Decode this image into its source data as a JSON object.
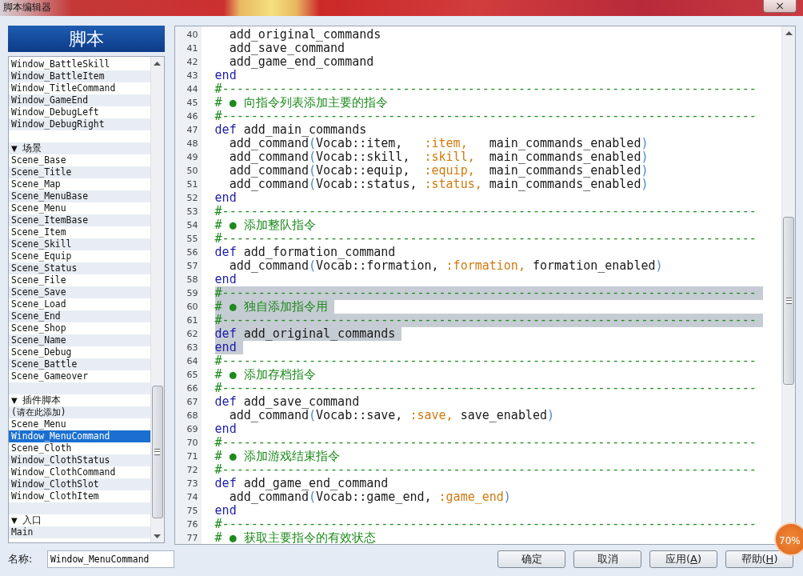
{
  "window": {
    "title": "脚本编辑器",
    "close": "×"
  },
  "panel": {
    "title": "脚本"
  },
  "script_list": {
    "items": [
      {
        "kind": "script",
        "label": "Window_BattleSkill",
        "selected": false
      },
      {
        "kind": "script",
        "label": "Window_BattleItem",
        "selected": false
      },
      {
        "kind": "script",
        "label": "Window_TitleCommand",
        "selected": false
      },
      {
        "kind": "script",
        "label": "Window_GameEnd",
        "selected": false
      },
      {
        "kind": "script",
        "label": "Window_DebugLeft",
        "selected": false
      },
      {
        "kind": "script",
        "label": "Window_DebugRight",
        "selected": false
      },
      {
        "kind": "blank",
        "selected": false
      },
      {
        "kind": "group",
        "arrow": "▼",
        "label": "场景",
        "selected": false
      },
      {
        "kind": "script",
        "label": "Scene_Base",
        "selected": false
      },
      {
        "kind": "script",
        "label": "Scene_Title",
        "selected": false
      },
      {
        "kind": "script",
        "label": "Scene_Map",
        "selected": false
      },
      {
        "kind": "script",
        "label": "Scene_MenuBase",
        "selected": false
      },
      {
        "kind": "script",
        "label": "Scene_Menu",
        "selected": false
      },
      {
        "kind": "script",
        "label": "Scene_ItemBase",
        "selected": false
      },
      {
        "kind": "script",
        "label": "Scene_Item",
        "selected": false
      },
      {
        "kind": "script",
        "label": "Scene_Skill",
        "selected": false
      },
      {
        "kind": "script",
        "label": "Scene_Equip",
        "selected": false
      },
      {
        "kind": "script",
        "label": "Scene_Status",
        "selected": false
      },
      {
        "kind": "script",
        "label": "Scene_File",
        "selected": false
      },
      {
        "kind": "script",
        "label": "Scene_Save",
        "selected": false
      },
      {
        "kind": "script",
        "label": "Scene_Load",
        "selected": false
      },
      {
        "kind": "script",
        "label": "Scene_End",
        "selected": false
      },
      {
        "kind": "script",
        "label": "Scene_Shop",
        "selected": false
      },
      {
        "kind": "script",
        "label": "Scene_Name",
        "selected": false
      },
      {
        "kind": "script",
        "label": "Scene_Debug",
        "selected": false
      },
      {
        "kind": "script",
        "label": "Scene_Battle",
        "selected": false
      },
      {
        "kind": "script",
        "label": "Scene_Gameover",
        "selected": false
      },
      {
        "kind": "blank",
        "selected": false
      },
      {
        "kind": "group",
        "arrow": "▼",
        "label": "插件脚本",
        "selected": false
      },
      {
        "kind": "script",
        "label": "(请在此添加)",
        "selected": false
      },
      {
        "kind": "script",
        "label": "Scene_Menu",
        "selected": false
      },
      {
        "kind": "script",
        "label": "Window_MenuCommand",
        "selected": true
      },
      {
        "kind": "script",
        "label": "Scene_Cloth",
        "selected": false
      },
      {
        "kind": "script",
        "label": "Window_ClothStatus",
        "selected": false
      },
      {
        "kind": "script",
        "label": "Window_ClothCommand",
        "selected": false
      },
      {
        "kind": "script",
        "label": "Window_ClothSlot",
        "selected": false
      },
      {
        "kind": "script",
        "label": "Window_ClothItem",
        "selected": false
      },
      {
        "kind": "blank",
        "selected": false
      },
      {
        "kind": "group",
        "arrow": "▼",
        "label": "入口",
        "selected": false
      },
      {
        "kind": "script",
        "label": "Main",
        "selected": false
      }
    ]
  },
  "editor": {
    "lines": [
      {
        "number": "40",
        "selected": false,
        "tokens": [
          {
            "kind": "plain",
            "text": "  add_original_commands"
          }
        ]
      },
      {
        "number": "41",
        "selected": false,
        "tokens": [
          {
            "kind": "plain",
            "text": "  add_save_command"
          }
        ]
      },
      {
        "number": "42",
        "selected": false,
        "tokens": [
          {
            "kind": "plain",
            "text": "  add_game_end_command"
          }
        ]
      },
      {
        "number": "43",
        "selected": false,
        "tokens": [
          {
            "kind": "keyword",
            "text": "end"
          }
        ]
      },
      {
        "number": "44",
        "selected": false,
        "tokens": [
          {
            "kind": "comment",
            "text": "#--------------------------------------------------------------------------"
          }
        ]
      },
      {
        "number": "45",
        "selected": false,
        "tokens": [
          {
            "kind": "comment",
            "text": "# ● 向指令列表添加主要的指令"
          }
        ]
      },
      {
        "number": "46",
        "selected": false,
        "tokens": [
          {
            "kind": "comment",
            "text": "#--------------------------------------------------------------------------"
          }
        ]
      },
      {
        "number": "47",
        "selected": false,
        "tokens": [
          {
            "kind": "keyword",
            "text": "def"
          },
          {
            "kind": "plain",
            "text": " add_main_commands"
          }
        ]
      },
      {
        "number": "48",
        "selected": false,
        "tokens": [
          {
            "kind": "plain",
            "text": "  add_command"
          },
          {
            "kind": "paren",
            "text": "("
          },
          {
            "kind": "plain",
            "text": "Vocab::item,   "
          },
          {
            "kind": "symbol",
            "text": ":item,"
          },
          {
            "kind": "plain",
            "text": "   main_commands_enabled"
          },
          {
            "kind": "paren",
            "text": ")"
          }
        ]
      },
      {
        "number": "49",
        "selected": false,
        "tokens": [
          {
            "kind": "plain",
            "text": "  add_command"
          },
          {
            "kind": "paren",
            "text": "("
          },
          {
            "kind": "plain",
            "text": "Vocab::skill,  "
          },
          {
            "kind": "symbol",
            "text": ":skill,"
          },
          {
            "kind": "plain",
            "text": "  main_commands_enabled"
          },
          {
            "kind": "paren",
            "text": ")"
          }
        ]
      },
      {
        "number": "50",
        "selected": false,
        "tokens": [
          {
            "kind": "plain",
            "text": "  add_command"
          },
          {
            "kind": "paren",
            "text": "("
          },
          {
            "kind": "plain",
            "text": "Vocab::equip,  "
          },
          {
            "kind": "symbol",
            "text": ":equip,"
          },
          {
            "kind": "plain",
            "text": "  main_commands_enabled"
          },
          {
            "kind": "paren",
            "text": ")"
          }
        ]
      },
      {
        "number": "51",
        "selected": false,
        "tokens": [
          {
            "kind": "plain",
            "text": "  add_command"
          },
          {
            "kind": "paren",
            "text": "("
          },
          {
            "kind": "plain",
            "text": "Vocab::status, "
          },
          {
            "kind": "symbol",
            "text": ":status,"
          },
          {
            "kind": "plain",
            "text": " main_commands_enabled"
          },
          {
            "kind": "paren",
            "text": ")"
          }
        ]
      },
      {
        "number": "52",
        "selected": false,
        "tokens": [
          {
            "kind": "keyword",
            "text": "end"
          }
        ]
      },
      {
        "number": "53",
        "selected": false,
        "tokens": [
          {
            "kind": "comment",
            "text": "#--------------------------------------------------------------------------"
          }
        ]
      },
      {
        "number": "54",
        "selected": false,
        "tokens": [
          {
            "kind": "comment",
            "text": "# ● 添加整队指令"
          }
        ]
      },
      {
        "number": "55",
        "selected": false,
        "tokens": [
          {
            "kind": "comment",
            "text": "#--------------------------------------------------------------------------"
          }
        ]
      },
      {
        "number": "56",
        "selected": false,
        "tokens": [
          {
            "kind": "keyword",
            "text": "def"
          },
          {
            "kind": "plain",
            "text": " add_formation_command"
          }
        ]
      },
      {
        "number": "57",
        "selected": false,
        "tokens": [
          {
            "kind": "plain",
            "text": "  add_command"
          },
          {
            "kind": "paren",
            "text": "("
          },
          {
            "kind": "plain",
            "text": "Vocab::formation, "
          },
          {
            "kind": "symbol",
            "text": ":formation,"
          },
          {
            "kind": "plain",
            "text": " formation_enabled"
          },
          {
            "kind": "paren",
            "text": ")"
          }
        ]
      },
      {
        "number": "58",
        "selected": false,
        "tokens": [
          {
            "kind": "keyword",
            "text": "end"
          }
        ]
      },
      {
        "number": "59",
        "selected": true,
        "tokens": [
          {
            "kind": "comment",
            "text": "#--------------------------------------------------------------------------"
          }
        ]
      },
      {
        "number": "60",
        "selected": true,
        "tokens": [
          {
            "kind": "comment",
            "text": "# ● 独自添加指令用"
          }
        ]
      },
      {
        "number": "61",
        "selected": true,
        "tokens": [
          {
            "kind": "comment",
            "text": "#--------------------------------------------------------------------------"
          }
        ]
      },
      {
        "number": "62",
        "selected": true,
        "tokens": [
          {
            "kind": "keyword",
            "text": "def"
          },
          {
            "kind": "plain",
            "text": " add_original_commands"
          }
        ]
      },
      {
        "number": "63",
        "selected": true,
        "tokens": [
          {
            "kind": "keyword",
            "text": "end"
          }
        ]
      },
      {
        "number": "64",
        "selected": false,
        "tokens": [
          {
            "kind": "comment",
            "text": "#--------------------------------------------------------------------------"
          }
        ]
      },
      {
        "number": "65",
        "selected": false,
        "tokens": [
          {
            "kind": "comment",
            "text": "# ● 添加存档指令"
          }
        ]
      },
      {
        "number": "66",
        "selected": false,
        "tokens": [
          {
            "kind": "comment",
            "text": "#--------------------------------------------------------------------------"
          }
        ]
      },
      {
        "number": "67",
        "selected": false,
        "tokens": [
          {
            "kind": "keyword",
            "text": "def"
          },
          {
            "kind": "plain",
            "text": " add_save_command"
          }
        ]
      },
      {
        "number": "68",
        "selected": false,
        "tokens": [
          {
            "kind": "plain",
            "text": "  add_command"
          },
          {
            "kind": "paren",
            "text": "("
          },
          {
            "kind": "plain",
            "text": "Vocab::save, "
          },
          {
            "kind": "symbol",
            "text": ":save,"
          },
          {
            "kind": "plain",
            "text": " save_enabled"
          },
          {
            "kind": "paren",
            "text": ")"
          }
        ]
      },
      {
        "number": "69",
        "selected": false,
        "tokens": [
          {
            "kind": "keyword",
            "text": "end"
          }
        ]
      },
      {
        "number": "70",
        "selected": false,
        "tokens": [
          {
            "kind": "comment",
            "text": "#--------------------------------------------------------------------------"
          }
        ]
      },
      {
        "number": "71",
        "selected": false,
        "tokens": [
          {
            "kind": "comment",
            "text": "# ● 添加游戏结束指令"
          }
        ]
      },
      {
        "number": "72",
        "selected": false,
        "tokens": [
          {
            "kind": "comment",
            "text": "#--------------------------------------------------------------------------"
          }
        ]
      },
      {
        "number": "73",
        "selected": false,
        "tokens": [
          {
            "kind": "keyword",
            "text": "def"
          },
          {
            "kind": "plain",
            "text": " add_game_end_command"
          }
        ]
      },
      {
        "number": "74",
        "selected": false,
        "tokens": [
          {
            "kind": "plain",
            "text": "  add_command"
          },
          {
            "kind": "paren",
            "text": "("
          },
          {
            "kind": "plain",
            "text": "Vocab::game_end, "
          },
          {
            "kind": "symbol",
            "text": ":game_end"
          },
          {
            "kind": "paren",
            "text": ")"
          }
        ]
      },
      {
        "number": "75",
        "selected": false,
        "tokens": [
          {
            "kind": "keyword",
            "text": "end"
          }
        ]
      },
      {
        "number": "76",
        "selected": false,
        "tokens": [
          {
            "kind": "comment",
            "text": "#--------------------------------------------------------------------------"
          }
        ]
      },
      {
        "number": "77",
        "selected": false,
        "tokens": [
          {
            "kind": "comment",
            "text": "# ● 获取主要指令的有效状态"
          }
        ]
      }
    ]
  },
  "name_field": {
    "label": "名称:",
    "value": "Window_MenuCommand"
  },
  "buttons": [
    {
      "label": "确定"
    },
    {
      "label": "取消"
    },
    {
      "label": "应用(",
      "mnemonic": "A",
      "suffix": ")"
    },
    {
      "label": "帮助(",
      "mnemonic": "H",
      "suffix": ")"
    }
  ],
  "overlay_badge": {
    "text": "70%"
  }
}
